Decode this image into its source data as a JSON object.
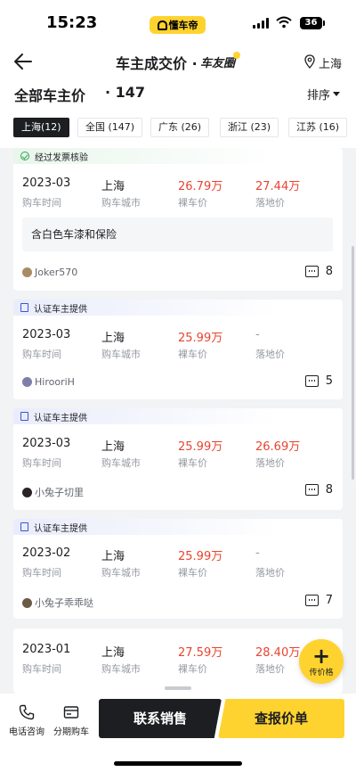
{
  "status_bar": {
    "time": "15:23",
    "app_pill_label": "懂车帝",
    "battery": "36"
  },
  "nav": {
    "title": "车主成交价 ·",
    "brand": "车友圈",
    "city": "上海"
  },
  "header": {
    "title": "全部车主价",
    "count": "· 147",
    "sort_label": "排序"
  },
  "tabs": [
    {
      "label": "上海(12)"
    },
    {
      "label": "全国 (147)"
    },
    {
      "label": "广东 (26)"
    },
    {
      "label": "浙江 (23)"
    },
    {
      "label": "江苏 (16)"
    }
  ],
  "field_labels": {
    "purchase_time": "购车时间",
    "purchase_city": "购车城市",
    "bare_price": "裸车价",
    "landing_price": "落地价"
  },
  "cards": [
    {
      "badge": "经过发票核验",
      "date": "2023-03",
      "city": "上海",
      "bare_price": "26.79万",
      "landing_price": "27.44万",
      "note": "含白色车漆和保险",
      "user": "Joker570",
      "comments": "8"
    },
    {
      "badge": "认证车主提供",
      "date": "2023-03",
      "city": "上海",
      "bare_price": "25.99万",
      "landing_price": "-",
      "user": "HirooriH",
      "comments": "5"
    },
    {
      "badge": "认证车主提供",
      "date": "2023-03",
      "city": "上海",
      "bare_price": "25.99万",
      "landing_price": "26.69万",
      "user": "小兔子切里",
      "comments": "8"
    },
    {
      "badge": "认证车主提供",
      "date": "2023-02",
      "city": "上海",
      "bare_price": "25.99万",
      "landing_price": "-",
      "user": "小兔子乖乖哒",
      "comments": "7"
    },
    {
      "date": "2023-01",
      "city": "上海",
      "bare_price": "27.59万",
      "landing_price": "28.40万"
    }
  ],
  "fab": {
    "plus": "+",
    "label": "传价格"
  },
  "bottom_bar": {
    "phone_label": "电话咨询",
    "installment_label": "分期购车",
    "contact_button": "联系销售",
    "price_button": "查报价单"
  },
  "colors": {
    "accent_yellow": "#ffd32f",
    "price_red": "#e9432f",
    "dark": "#1d1e21"
  }
}
